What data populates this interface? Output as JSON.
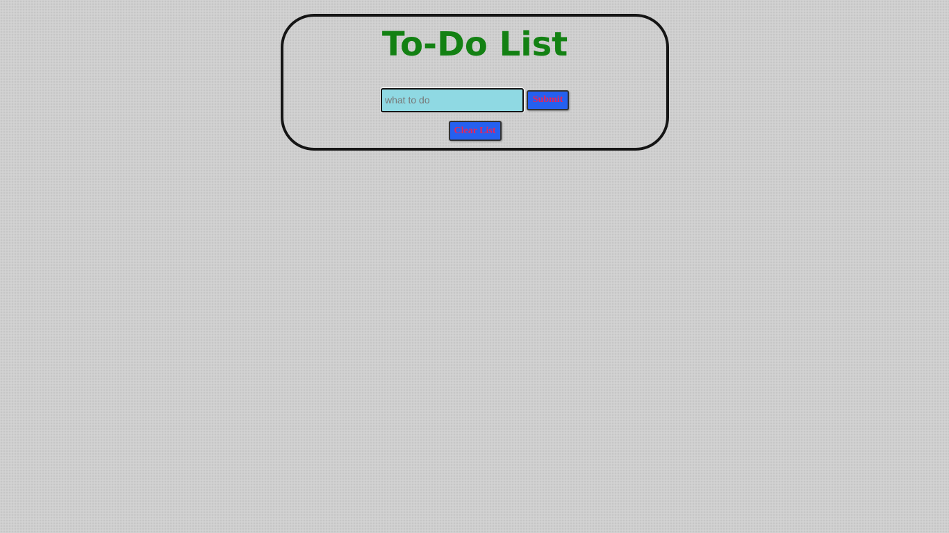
{
  "header": {
    "title": "To-Do List"
  },
  "form": {
    "input_value": "",
    "input_placeholder": "what to do",
    "submit_label": "Submit",
    "clear_label": "Clear List"
  },
  "colors": {
    "title": "#138113",
    "input_background": "#8fd9e3",
    "button_background": "#2560f0",
    "button_text": "#e8245a",
    "card_border": "#151515",
    "page_background": "#cfcfcf"
  }
}
